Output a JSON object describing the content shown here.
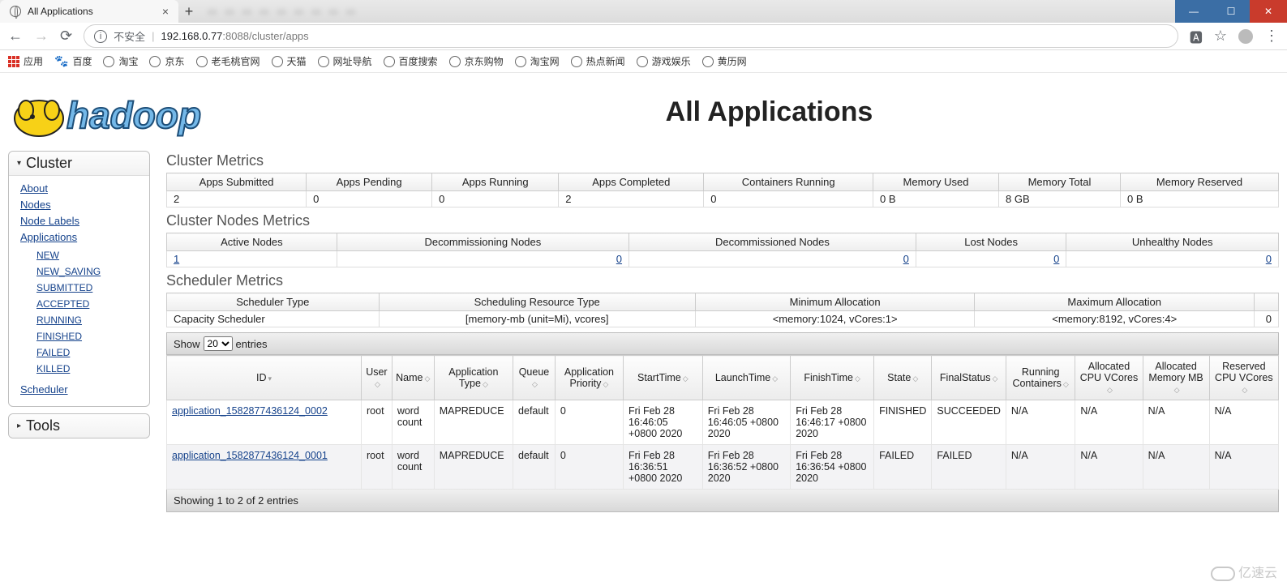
{
  "browser": {
    "tab_title": "All Applications",
    "insecure_label": "不安全",
    "url_host": "192.168.0.77",
    "url_port": ":8088",
    "url_path": "/cluster/apps",
    "apps_label": "应用",
    "bookmarks": [
      "百度",
      "淘宝",
      "京东",
      "老毛桃官网",
      "天猫",
      "网址导航",
      "百度搜索",
      "京东购物",
      "淘宝网",
      "热点新闻",
      "游戏娱乐",
      "黄历网"
    ]
  },
  "page_title": "All Applications",
  "nav": {
    "cluster": "Cluster",
    "tools": "Tools",
    "links": {
      "about": "About",
      "nodes": "Nodes",
      "nodelabels": "Node Labels",
      "applications": "Applications",
      "scheduler": "Scheduler"
    },
    "states": [
      "NEW",
      "NEW_SAVING",
      "SUBMITTED",
      "ACCEPTED",
      "RUNNING",
      "FINISHED",
      "FAILED",
      "KILLED"
    ]
  },
  "sections": {
    "cluster_metrics": "Cluster Metrics",
    "cluster_nodes": "Cluster Nodes Metrics",
    "scheduler_metrics": "Scheduler Metrics"
  },
  "cluster_metrics": {
    "headers": [
      "Apps Submitted",
      "Apps Pending",
      "Apps Running",
      "Apps Completed",
      "Containers Running",
      "Memory Used",
      "Memory Total",
      "Memory Reserved"
    ],
    "values": [
      "2",
      "0",
      "0",
      "2",
      "0",
      "0 B",
      "8 GB",
      "0 B"
    ]
  },
  "nodes_metrics": {
    "headers": [
      "Active Nodes",
      "Decommissioning Nodes",
      "Decommissioned Nodes",
      "Lost Nodes",
      "Unhealthy Nodes"
    ],
    "values": [
      "1",
      "0",
      "0",
      "0",
      "0"
    ]
  },
  "scheduler": {
    "headers": [
      "Scheduler Type",
      "Scheduling Resource Type",
      "Minimum Allocation",
      "Maximum Allocation",
      ""
    ],
    "values": [
      "Capacity Scheduler",
      "[memory-mb (unit=Mi), vcores]",
      "<memory:1024, vCores:1>",
      "<memory:8192, vCores:4>",
      "0"
    ]
  },
  "dt": {
    "show": "Show",
    "entries": "entries",
    "len_value": "20",
    "info": "Showing 1 to 2 of 2 entries"
  },
  "app_headers": [
    "ID",
    "User",
    "Name",
    "Application Type",
    "Queue",
    "Application Priority",
    "StartTime",
    "LaunchTime",
    "FinishTime",
    "State",
    "FinalStatus",
    "Running Containers",
    "Allocated CPU VCores",
    "Allocated Memory MB",
    "Reserved CPU VCores"
  ],
  "apps": [
    {
      "id": "application_1582877436124_0002",
      "user": "root",
      "name": "word count",
      "type": "MAPREDUCE",
      "queue": "default",
      "priority": "0",
      "start": "Fri Feb 28 16:46:05 +0800 2020",
      "launch": "Fri Feb 28 16:46:05 +0800 2020",
      "finish": "Fri Feb 28 16:46:17 +0800 2020",
      "state": "FINISHED",
      "final": "SUCCEEDED",
      "rc": "N/A",
      "cpu": "N/A",
      "mem": "N/A",
      "rcpu": "N/A"
    },
    {
      "id": "application_1582877436124_0001",
      "user": "root",
      "name": "word count",
      "type": "MAPREDUCE",
      "queue": "default",
      "priority": "0",
      "start": "Fri Feb 28 16:36:51 +0800 2020",
      "launch": "Fri Feb 28 16:36:52 +0800 2020",
      "finish": "Fri Feb 28 16:36:54 +0800 2020",
      "state": "FAILED",
      "final": "FAILED",
      "rc": "N/A",
      "cpu": "N/A",
      "mem": "N/A",
      "rcpu": "N/A"
    }
  ],
  "watermark": "亿速云"
}
